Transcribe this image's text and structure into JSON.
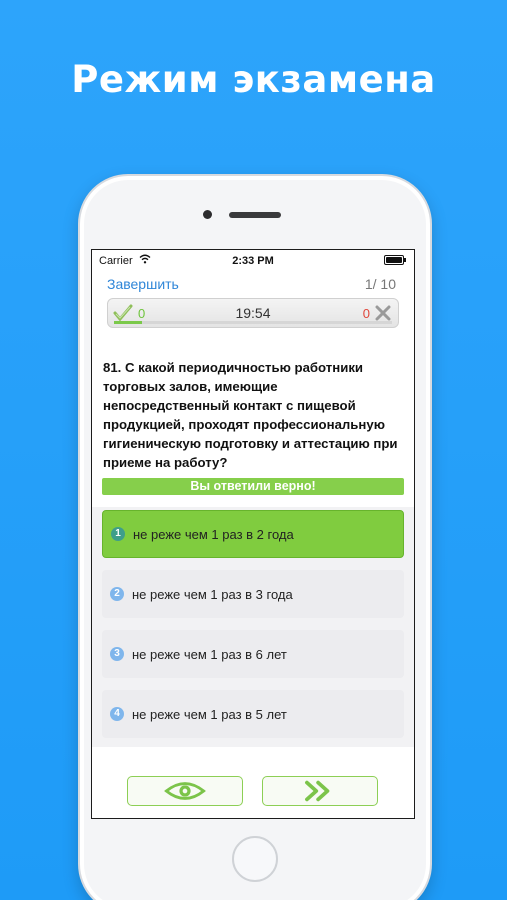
{
  "headline": "Режим экзамена",
  "status_bar": {
    "carrier": "Carrier",
    "time": "2:33 PM"
  },
  "nav": {
    "finish_label": "Завершить",
    "progress": "1/ 10"
  },
  "score": {
    "correct": "0",
    "timer": "19:54",
    "wrong": "0"
  },
  "question": "81. С какой периодичностью работники торговых залов, имеющие непосредственный контакт с пищевой продукцией, проходят профессиональную гигиеническую подготовку и аттестацию при приеме на работу?",
  "result_banner": "Вы ответили верно!",
  "answers": [
    {
      "num": "1",
      "text": "не реже чем 1 раз в 2 года"
    },
    {
      "num": "2",
      "text": "не реже чем 1 раз в 3 года"
    },
    {
      "num": "3",
      "text": "не реже чем 1 раз в 6 лет"
    },
    {
      "num": "4",
      "text": "не реже чем 1 раз в 5 лет"
    }
  ],
  "colors": {
    "background": "#1e9bf7",
    "accent_green": "#80cc3f",
    "link_blue": "#2f86d8",
    "wrong_red": "#e0463b"
  },
  "icons": {
    "check": "check-icon",
    "cross": "cross-icon",
    "eye": "eye-icon",
    "skip": "double-chevron-right-icon",
    "wifi": "wifi-icon",
    "battery": "battery-icon"
  }
}
